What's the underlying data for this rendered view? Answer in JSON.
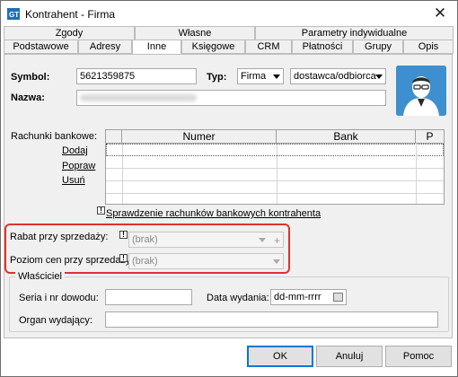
{
  "window": {
    "title": "Kontrahent - Firma",
    "close_glyph": "✕"
  },
  "tabs_top": [
    {
      "label": "Zgody"
    },
    {
      "label": "Własne"
    },
    {
      "label": "Parametry indywidualne"
    }
  ],
  "tabs_bottom": [
    {
      "label": "Podstawowe"
    },
    {
      "label": "Adresy"
    },
    {
      "label": "Inne",
      "active": true
    },
    {
      "label": "Księgowe"
    },
    {
      "label": "CRM"
    },
    {
      "label": "Płatności"
    },
    {
      "label": "Grupy"
    },
    {
      "label": "Opis"
    }
  ],
  "form": {
    "symbol_label": "Symbol:",
    "symbol_value": "5621359875",
    "typ_label": "Typ:",
    "typ_value": "Firma",
    "role_value": "dostawca/odbiorca",
    "nazwa_label": "Nazwa:"
  },
  "bank": {
    "label": "Rachunki bankowe:",
    "add": "Dodaj",
    "edit": "Popraw",
    "delete": "Usuń",
    "columns": [
      "Numer",
      "Bank",
      "P"
    ],
    "verify_link": "Sprawdzenie rachunków bankowych kontrahenta",
    "warn_glyph": "!"
  },
  "discount": {
    "rabat_label": "Rabat przy sprzedaży:",
    "rabat_value": "(brak)",
    "plus_glyph": "+",
    "poziom_label": "Poziom cen przy sprzedaży:",
    "poziom_value": "(brak)",
    "highlight_color": "#e03131"
  },
  "owner": {
    "group_title": "Właściciel",
    "id_label": "Seria i nr dowodu:",
    "issue_date_label": "Data wydania:",
    "issue_date_value": "dd-mm-rrrr",
    "authority_label": "Organ wydający:"
  },
  "buttons": {
    "ok": "OK",
    "cancel": "Anuluj",
    "help": "Pomoc"
  },
  "icons": {
    "app": "app-logo-icon",
    "avatar": "contact-avatar-icon",
    "calendar": "calendar-icon"
  },
  "colors": {
    "accent": "#0078d7",
    "avatar_bg": "#3e8fcf"
  }
}
